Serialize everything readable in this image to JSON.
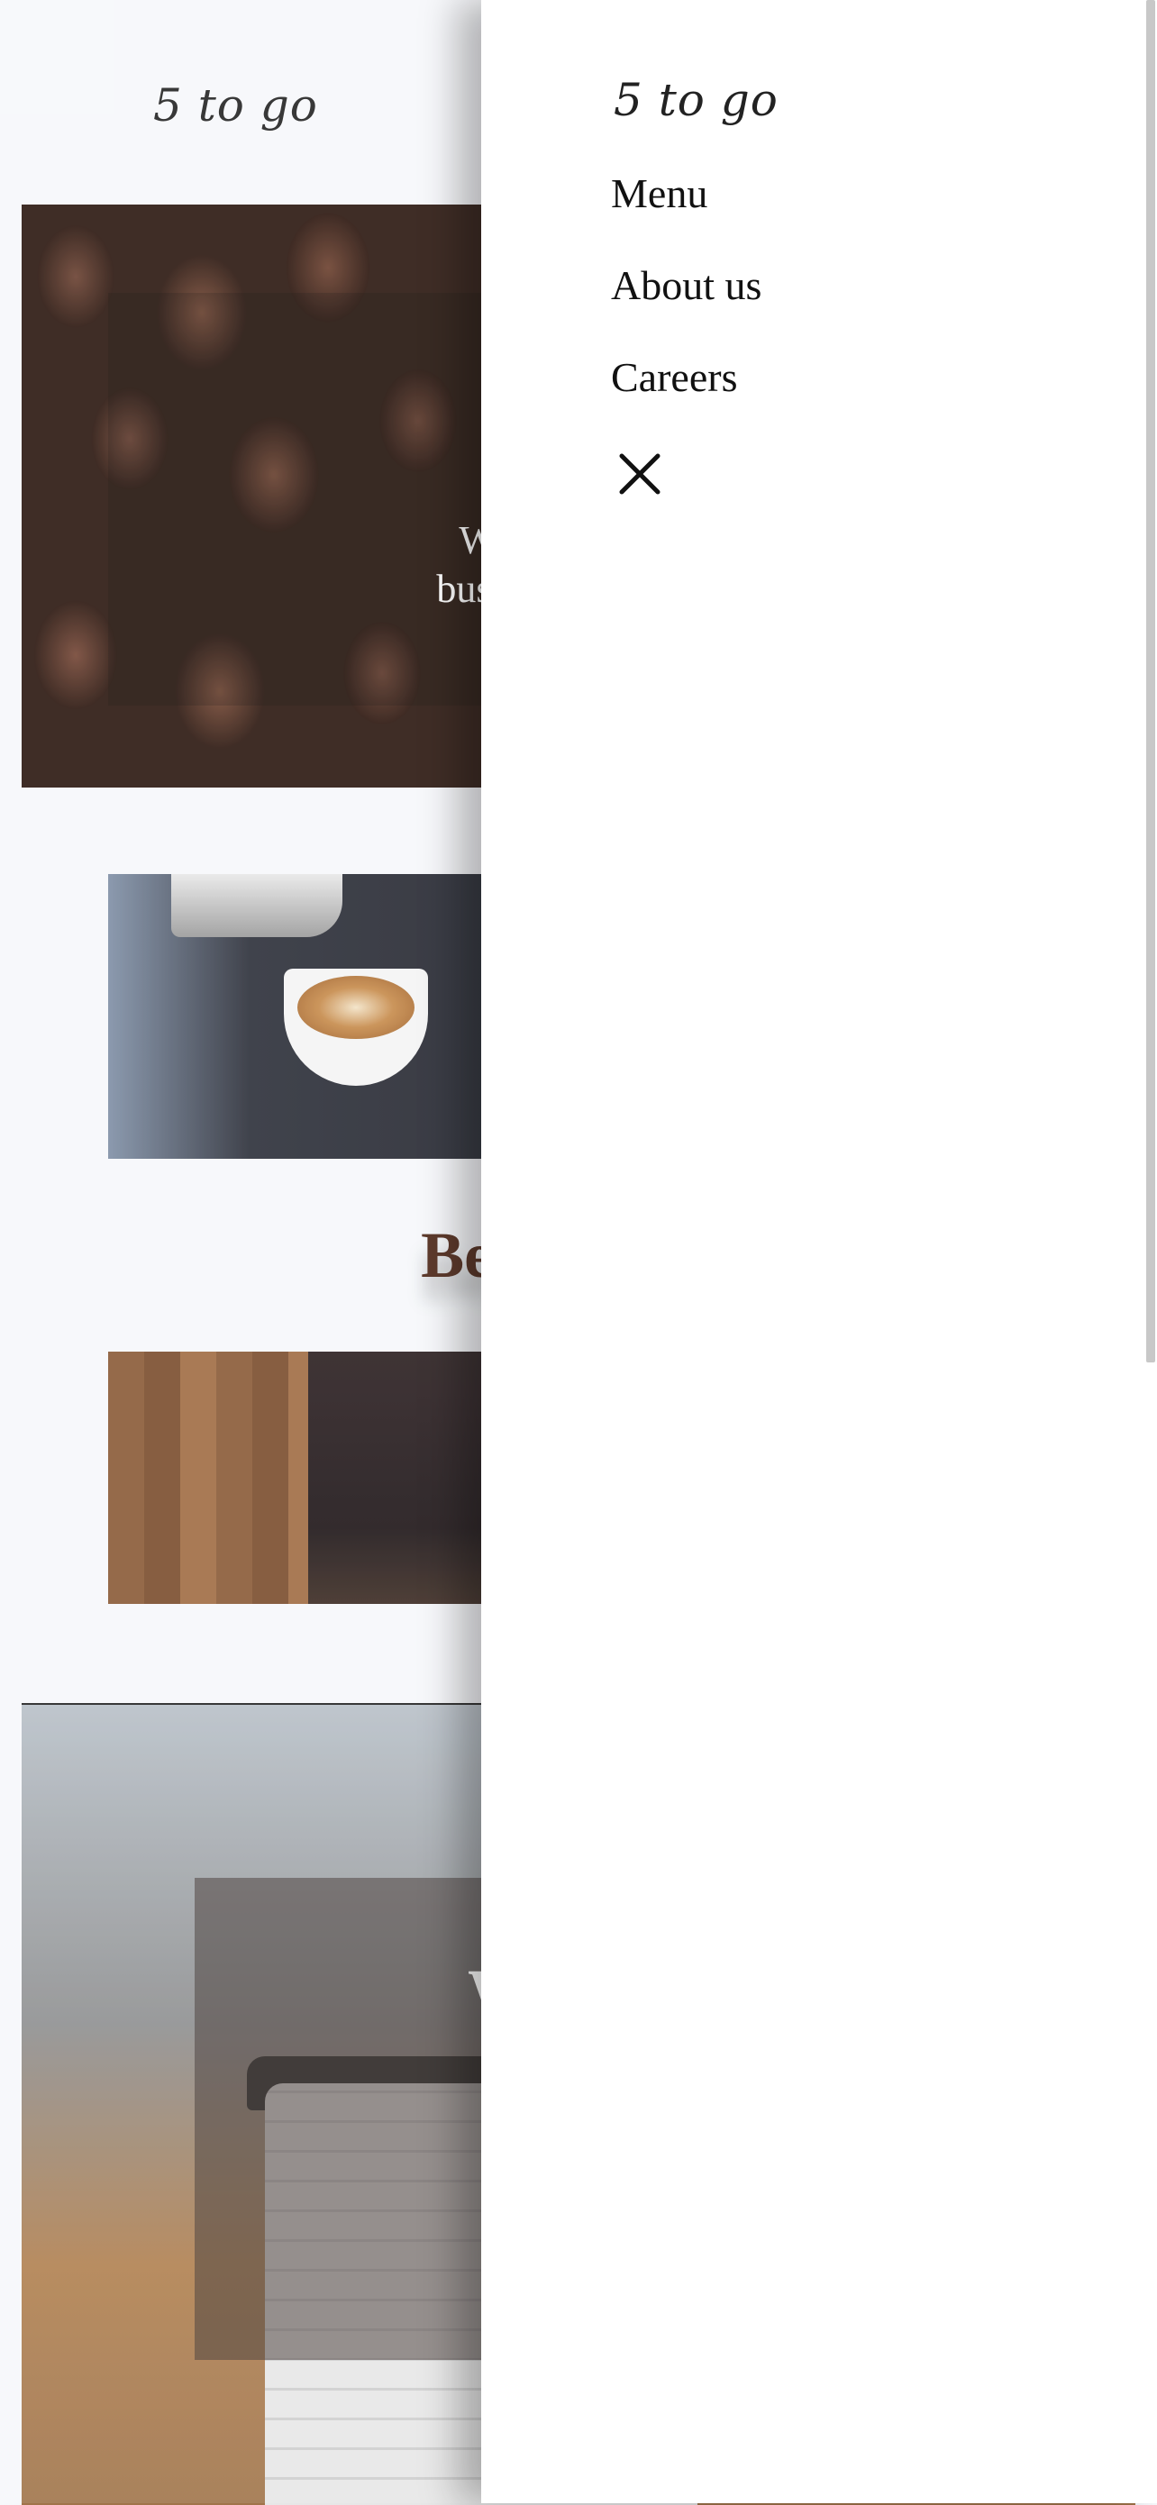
{
  "site": {
    "logo": "5 to go"
  },
  "main": {
    "hero_text_line1": "Welcome to ou",
    "hero_text_line2": "business born and",
    "best_heading": "Best Coffee",
    "want_heading": "Want to"
  },
  "drawer": {
    "logo": "5 to go",
    "items": [
      {
        "label": "Menu"
      },
      {
        "label": "About us"
      },
      {
        "label": "Careers"
      }
    ],
    "close_icon": "close-icon"
  }
}
